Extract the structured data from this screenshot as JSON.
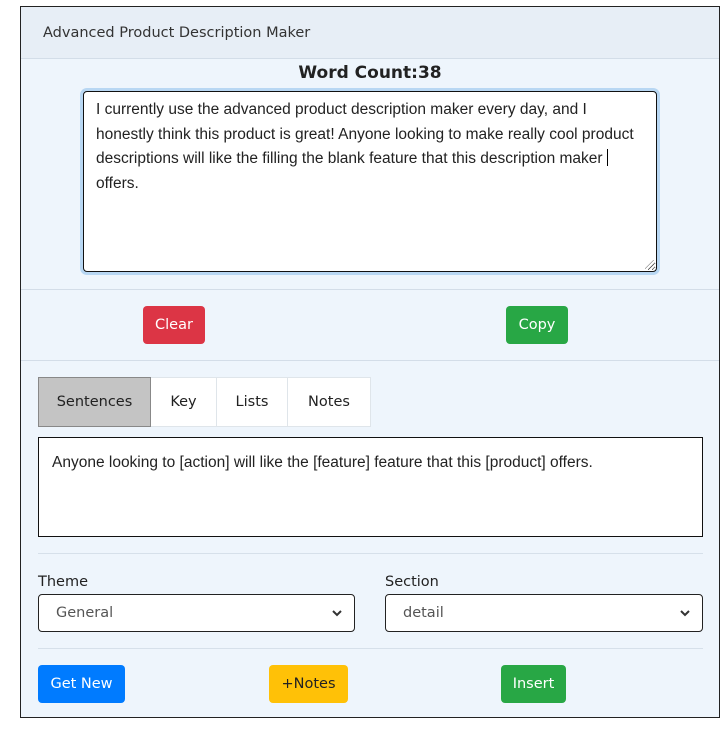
{
  "header": {
    "title": "Advanced Product Description Maker"
  },
  "word_count": {
    "label": "Word Count:",
    "value": "38",
    "display": "Word Count:38"
  },
  "editor": {
    "text_before_caret": " I currently use the advanced product description maker every day, and I honestly think this product is great! Anyone looking to make really cool product descriptions will like the filling the blank feature that this description maker ",
    "text_after_caret": "offers."
  },
  "actions": {
    "clear_label": "Clear",
    "copy_label": "Copy"
  },
  "tabs": [
    {
      "label": "Sentences",
      "active": true
    },
    {
      "label": "Key",
      "active": false
    },
    {
      "label": "Lists",
      "active": false
    },
    {
      "label": "Notes",
      "active": false
    }
  ],
  "sentence_template": "Anyone looking to [action] will like the [feature] feature that this [product] offers.",
  "theme": {
    "label": "Theme",
    "selected": "General"
  },
  "section": {
    "label": "Section",
    "selected": "detail"
  },
  "bottom_actions": {
    "get_new_label": "Get New",
    "notes_label": "+Notes",
    "insert_label": "Insert"
  },
  "colors": {
    "danger": "#dc3545",
    "success": "#28a745",
    "primary": "#007bff",
    "warning": "#ffc107",
    "active_tab": "#c4c4c4",
    "card_bg": "#eef5fc"
  }
}
